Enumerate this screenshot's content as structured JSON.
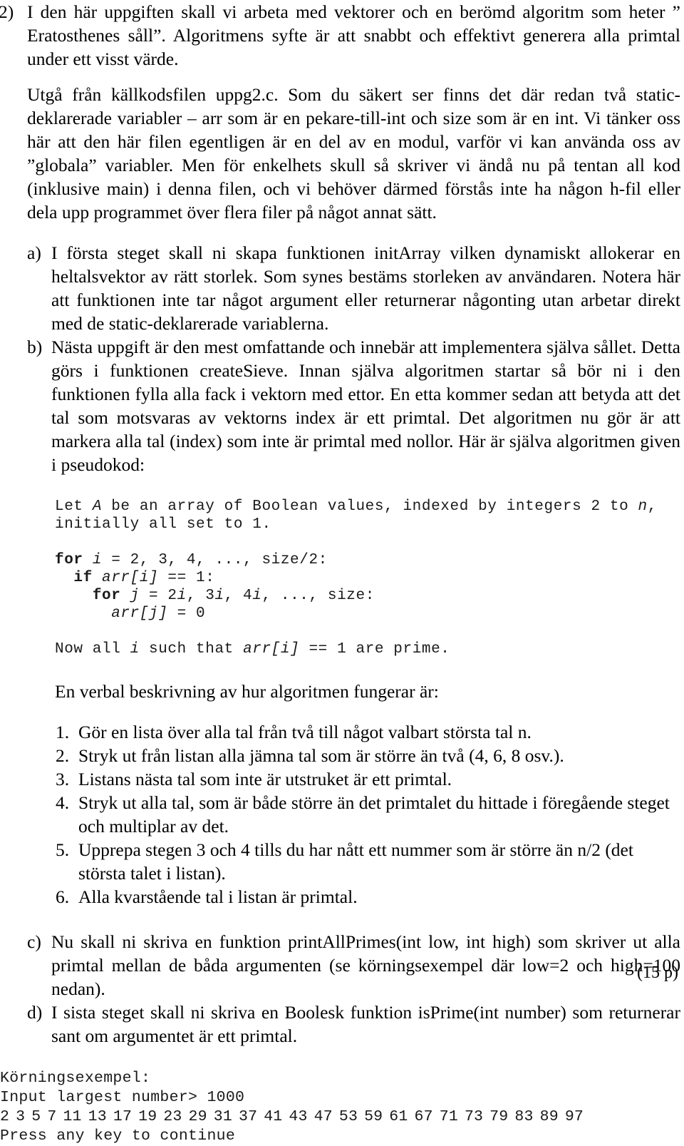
{
  "question": {
    "marker": "2)",
    "paragraphs": [
      "I den här uppgiften skall vi arbeta med vektorer och en berömd algoritm som heter ” Eratosthenes såll”. Algoritmens syfte är att snabbt och effektivt generera alla primtal under ett visst värde.",
      "Utgå från källkodsfilen uppg2.c. Som du säkert ser finns det där redan två static-deklarerade variabler – arr som är en pekare-till-int och size som är en int. Vi tänker oss här att den här filen egentligen är en del av en modul, varför vi kan använda oss av ”globala” variabler. Men för enkelhets skull så skriver vi ändå nu på tentan all kod (inklusive main) i denna filen, och vi behöver därmed förstås inte ha någon h-fil eller dela upp programmet över flera filer på något annat sätt."
    ],
    "points": "(15 p)"
  },
  "subitems": {
    "a": {
      "marker": "a)",
      "text": "I första steget skall ni skapa funktionen initArray vilken dynamiskt allokerar en heltalsvektor av rätt storlek. Som synes bestäms storleken av användaren. Notera här att funktionen inte tar något argument eller returnerar någonting utan arbetar direkt med de static-deklarerade variablerna."
    },
    "b": {
      "marker": "b)",
      "text": "Nästa uppgift är den mest omfattande och innebär att implementera själva sållet. Detta görs i funktionen createSieve. Innan själva algoritmen startar så bör ni i den funktionen fylla alla fack i vektorn med ettor. En etta kommer sedan att betyda att det tal som motsvaras av vektorns index är ett primtal. Det algoritmen nu gör är att markera alla tal (index) som inte är primtal med nollor. Här är själva algoritmen given i pseudokod:"
    },
    "c": {
      "marker": "c)",
      "text": "Nu skall ni skriva en funktion printAllPrimes(int low, int high) som skriver ut alla primtal mellan de båda argumenten (se körningsexempel där low=2 och high=100 nedan)."
    },
    "d": {
      "marker": "d)",
      "text": "I sista steget skall ni skriva en Boolesk funktion isPrime(int number) som returnerar sant om argumentet är ett primtal."
    }
  },
  "pseudocode": {
    "line1_a": "Let ",
    "line1_var": "A",
    "line1_b": " be an array of Boolean values, indexed by integers 2 to ",
    "line1_n": "n",
    "line1_c": ",",
    "line2": "initially all set to 1.",
    "line3_kw": "for",
    "line3_i": "i",
    "line3_rest": " = 2, 3, 4, ..., size/2:",
    "line4_indent": "  ",
    "line4_kw": "if",
    "line4_arr": "arr[i]",
    "line4_rest": " == 1:",
    "line5_indent": "    ",
    "line5_kw": "for",
    "line5_j": "j",
    "line5_rest": " = 2",
    "line5_j2": "i",
    "line5_rest2": ", 3",
    "line5_j3": "i",
    "line5_rest3": ", 4",
    "line5_j4": "i",
    "line5_rest4": ", ..., size:",
    "line6_indent": "      ",
    "line6_arr": "arr[j]",
    "line6_rest": " = 0",
    "line7_a": "Now all ",
    "line7_i": "i",
    "line7_b": " such that ",
    "line7_arr": "arr[i]",
    "line7_c": " == 1 are prime."
  },
  "verbal": {
    "intro": "En verbal beskrivning av hur algoritmen fungerar är:",
    "steps": [
      {
        "marker": "1.",
        "text": "Gör en lista över alla tal från två till något valbart största tal n."
      },
      {
        "marker": "2.",
        "text": "Stryk ut från listan alla jämna tal som är större än två (4, 6, 8 osv.)."
      },
      {
        "marker": "3.",
        "text": "Listans nästa tal som inte är utstruket är ett primtal."
      },
      {
        "marker": "4.",
        "text": "Stryk ut alla tal, som är både större än det primtalet du hittade i föregående steget och multiplar av det."
      },
      {
        "marker": "5.",
        "text": "Upprepa stegen 3 och 4 tills du har nått ett nummer som är större än n/2 (det största talet i listan)."
      },
      {
        "marker": "6.",
        "text": "Alla kvarstående tal i listan är primtal."
      }
    ]
  },
  "console": {
    "title": "Körningsexempel:",
    "prompt": "Input largest number> 1000",
    "primes": [
      2,
      3,
      5,
      7,
      11,
      13,
      17,
      19,
      23,
      29,
      31,
      37,
      41,
      43,
      47,
      53,
      59,
      61,
      67,
      71,
      73,
      79,
      83,
      89,
      97
    ],
    "footer": "Press any key to continue"
  }
}
